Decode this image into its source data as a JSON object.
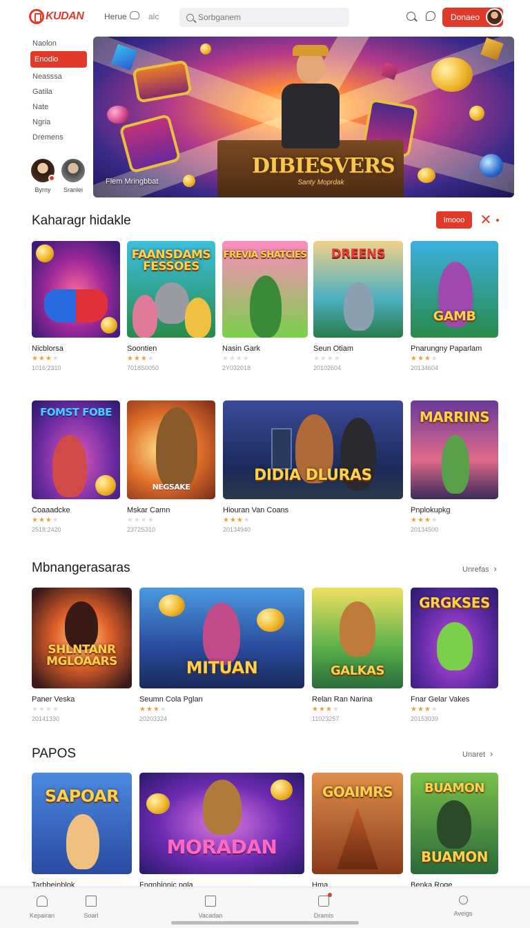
{
  "header": {
    "logo_text": "KUDAN",
    "nav_home": "Herue",
    "nav_link": "alc",
    "search_placeholder": "Sorbganem",
    "action_button": "Donaeo",
    "colors": {
      "accent": "#e23a2a"
    }
  },
  "sidebar": {
    "items": [
      {
        "label": "Naolon",
        "active": false
      },
      {
        "label": "Enodio",
        "active": true
      },
      {
        "label": "Neasssa",
        "active": false
      },
      {
        "label": "Gatila",
        "active": false
      },
      {
        "label": "Nate",
        "active": false
      },
      {
        "label": "Ngria",
        "active": false
      },
      {
        "label": "Dremens",
        "active": false
      }
    ],
    "friends": [
      {
        "name": "Byrny"
      },
      {
        "name": "Sranlei"
      }
    ]
  },
  "hero": {
    "title": "DIBIESVERS",
    "subtitle": "Santy Moprdak",
    "caption": "Flem Mringbbat"
  },
  "section1": {
    "title": "Kaharagr hidakle",
    "button": "Imooo",
    "games_row1": [
      {
        "name": "Nicblorsa",
        "stars": 3,
        "date": "1016;2310",
        "thumb_text": ""
      },
      {
        "name": "Soontien",
        "stars": 3,
        "date": "7018S0050",
        "thumb_text": "FAANSDAMS FESSOES"
      },
      {
        "name": "Nasin Gark",
        "stars": 0,
        "date": "2Y032018",
        "thumb_text": "FREVIA SHATCIES"
      },
      {
        "name": "Seun Otiam",
        "stars": 0,
        "date": "20102604",
        "thumb_text": "DREENS"
      },
      {
        "name": "Pnarungny Paparlam",
        "stars": 3,
        "date": "20134604",
        "thumb_text": "GAMB"
      }
    ],
    "games_row2": [
      {
        "name": "Coaaadcke",
        "stars": 3,
        "date": "2518:2420",
        "thumb_text": "FOMST FOBE"
      },
      {
        "name": "Mskar Camn",
        "stars": 0,
        "date": "2372S310",
        "thumb_text": "NEGSAKE"
      },
      {
        "name": "Hiouran Van Coans",
        "stars": 3,
        "date": "20134940",
        "thumb_text": "DIDIA DLURAS"
      },
      {
        "name": "Pnplokupkg",
        "stars": 3,
        "date": "20134500",
        "thumb_text": "MARRINS"
      }
    ]
  },
  "section2": {
    "title": "Mbnangerasaras",
    "more": "Unrefas",
    "games": [
      {
        "name": "Paner Veska",
        "stars": 0,
        "date": "20141330",
        "thumb_text": "SHLNTANR MGLOAARS"
      },
      {
        "name": "Seumn Cola Pglan",
        "stars": 3,
        "date": "20203324",
        "thumb_text": "MITUAN"
      },
      {
        "name": "Relan Ran Narina",
        "stars": 3,
        "date": "11023257",
        "thumb_text": "GALKAS"
      },
      {
        "name": "Fnar Gelar Vakes",
        "stars": 3,
        "date": "20153039",
        "thumb_text": "GRGKSES"
      }
    ]
  },
  "section3": {
    "title": "PAPOS",
    "more": "Unaret",
    "games": [
      {
        "name": "Tarbbeinblok",
        "thumb_text": "SAPOAR"
      },
      {
        "name": "Fngnhinnic pgla",
        "thumb_text": "MORADAN"
      },
      {
        "name": "Hma",
        "thumb_text": "GOAIMRS"
      },
      {
        "name": "Benka Roge",
        "thumb_text": "BUAMON"
      }
    ]
  },
  "tabbar": {
    "tabs": [
      {
        "label": "Kepairan",
        "icon": "home-icon"
      },
      {
        "label": "Soarl",
        "icon": "document-icon"
      },
      {
        "label": "Vacadan",
        "icon": "tablet-icon"
      },
      {
        "label": "Dramis",
        "icon": "cart-icon"
      },
      {
        "label": "Aveigs",
        "icon": "user-icon"
      }
    ]
  }
}
